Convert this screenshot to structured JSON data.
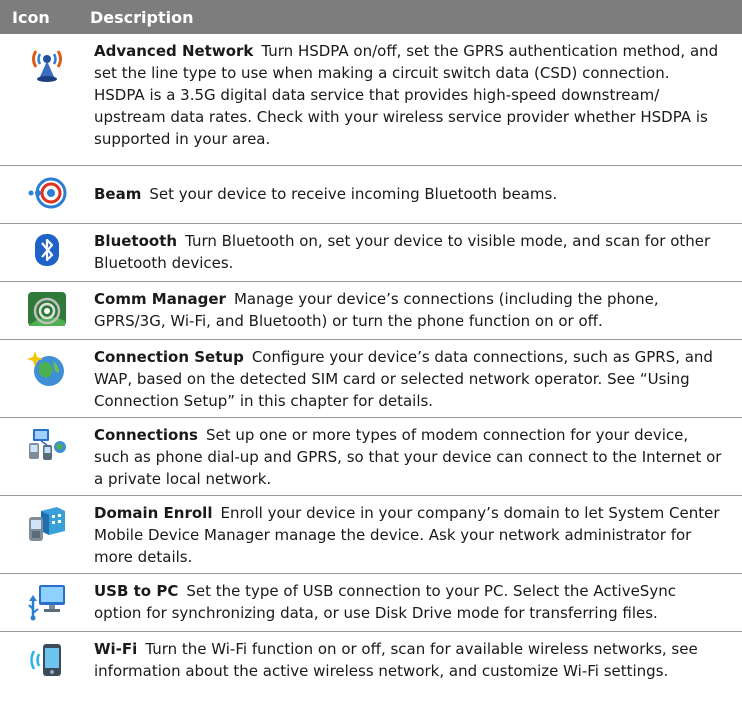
{
  "header": {
    "icon_col": "Icon",
    "desc_col": "Description"
  },
  "rows": [
    {
      "icon": "advanced-network-icon",
      "title": "Advanced Network",
      "text": "Turn HSDPA on/off, set the GPRS authentication method, and set the line type to use when making a circuit switch data (CSD) connection. HSDPA is a 3.5G digital data service that provides high-speed downstream/ upstream data rates. Check with your wireless service provider whether HSDPA is supported in your area."
    },
    {
      "icon": "beam-icon",
      "title": "Beam",
      "text": "Set your device to receive incoming Bluetooth beams."
    },
    {
      "icon": "bluetooth-icon",
      "title": "Bluetooth",
      "text": "Turn Bluetooth on, set your device to visible mode, and scan for other Bluetooth devices."
    },
    {
      "icon": "comm-manager-icon",
      "title": "Comm Manager",
      "text": "Manage your device’s connections (including the phone, GPRS/3G, Wi-Fi, and Bluetooth) or turn the phone function on or off."
    },
    {
      "icon": "connection-setup-icon",
      "title": "Connection Setup",
      "text": "Configure your device’s data connections, such as GPRS, and WAP, based on the detected SIM card or selected network operator. See “Using Connection Setup” in this chapter for details."
    },
    {
      "icon": "connections-icon",
      "title": "Connections",
      "text": "Set up one or more types of modem connection for your device, such as phone dial-up and GPRS, so that your device can connect to the Internet or a private local network."
    },
    {
      "icon": "domain-enroll-icon",
      "title": "Domain Enroll",
      "text": "Enroll your device in your company’s domain to let System Center Mobile Device Manager manage the device. Ask your network administrator for more details."
    },
    {
      "icon": "usb-to-pc-icon",
      "title": "USB to PC",
      "text": "Set the type of USB connection to your PC. Select the ActiveSync option for synchronizing data, or use Disk Drive mode for transferring files."
    },
    {
      "icon": "wifi-icon",
      "title": "Wi-Fi",
      "text": "Turn the Wi-Fi function on or off, scan for available wireless networks, see information about the active wireless network, and customize Wi-Fi settings."
    }
  ]
}
